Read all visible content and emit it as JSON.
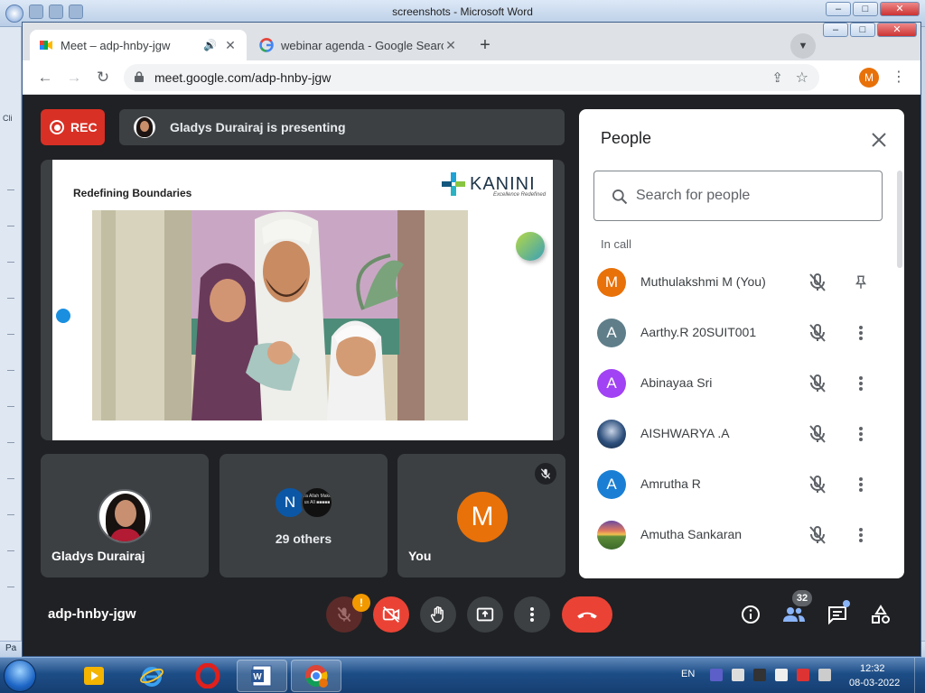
{
  "word": {
    "title": "screenshots - Microsoft Word",
    "status_text": "Pa",
    "side_labels": [
      "Cli",
      "Pa"
    ]
  },
  "chrome": {
    "tabs": [
      {
        "label": "Meet – adp-hnby-jgw",
        "active": true
      },
      {
        "label": "webinar agenda - Google Search",
        "active": false
      }
    ],
    "url": "meet.google.com/adp-hnby-jgw",
    "profile_initial": "M"
  },
  "meet": {
    "rec_label": "REC",
    "presenting_text": "Gladys Durairaj is presenting",
    "slide": {
      "title": "Redefining Boundaries",
      "logo_text": "KANINI",
      "logo_tagline": "Excellence Redefined"
    },
    "tiles": {
      "gladys_name": "Gladys Durairaj",
      "others_avatar_initial": "N",
      "others_avatar_text": "Ya Allah Make us All ■■■■■",
      "others_label": "29 others",
      "you_initial": "M",
      "you_name": "You"
    },
    "meeting_code": "adp-hnby-jgw",
    "people_count": "32",
    "mic_warning": "!",
    "colors": {
      "record": "#d93025",
      "leave": "#ea4335",
      "self_avatar": "#e8710a"
    }
  },
  "people": {
    "title": "People",
    "search_placeholder": "Search for people",
    "section_label": "In call",
    "list": [
      {
        "initial": "M",
        "name": "Muthulakshmi M (You)",
        "color": "#e8710a",
        "action": "pin-icon"
      },
      {
        "initial": "A",
        "name": "Aarthy.R 20SUIT001",
        "color": "#5f7e8a",
        "action": "more-vert-icon"
      },
      {
        "initial": "A",
        "name": "Abinayaa Sri",
        "color": "#a142f4",
        "action": "more-vert-icon"
      },
      {
        "initial": "",
        "name": "AISHWARYA .A",
        "color": "#2d4f7c",
        "action": "more-vert-icon"
      },
      {
        "initial": "A",
        "name": "Amrutha R",
        "color": "#1a7fd4",
        "action": "more-vert-icon"
      },
      {
        "initial": "",
        "name": "Amutha Sankaran",
        "color": "#6b8e3e",
        "action": "more-vert-icon"
      }
    ]
  },
  "taskbar": {
    "language": "EN",
    "time": "12:32",
    "date": "08-03-2022"
  }
}
